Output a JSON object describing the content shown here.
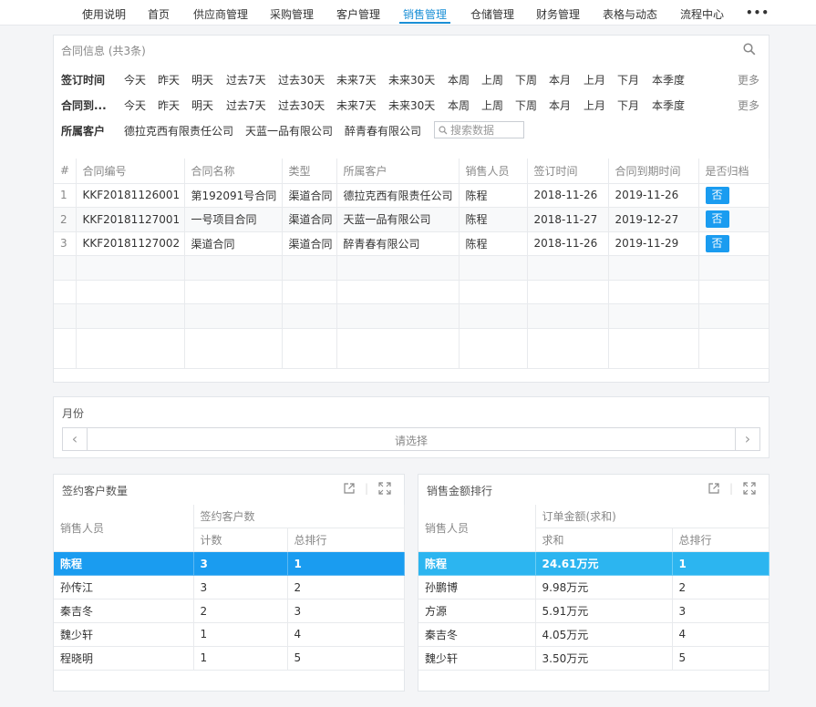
{
  "nav": {
    "items": [
      "使用说明",
      "首页",
      "供应商管理",
      "采购管理",
      "客户管理",
      "销售管理",
      "仓储管理",
      "财务管理",
      "表格与动态",
      "流程中心"
    ],
    "active": "销售管理",
    "more": "•••"
  },
  "contract": {
    "title": "合同信息 (共3条)",
    "filters": [
      {
        "label": "签订时间",
        "options": [
          "今天",
          "昨天",
          "明天",
          "过去7天",
          "过去30天",
          "未来7天",
          "未来30天",
          "本周",
          "上周",
          "下周",
          "本月",
          "上月",
          "下月",
          "本季度"
        ],
        "more": "更多"
      },
      {
        "label": "合同到...",
        "options": [
          "今天",
          "昨天",
          "明天",
          "过去7天",
          "过去30天",
          "未来7天",
          "未来30天",
          "本周",
          "上周",
          "下周",
          "本月",
          "上月",
          "下月",
          "本季度"
        ],
        "more": "更多"
      }
    ],
    "customer_filter": {
      "label": "所属客户",
      "options": [
        "德拉克西有限责任公司",
        "天蓝一品有限公司",
        "醉青春有限公司"
      ],
      "search_placeholder": "搜索数据"
    },
    "columns": [
      "#",
      "合同编号",
      "合同名称",
      "类型",
      "所属客户",
      "销售人员",
      "签订时间",
      "合同到期时间",
      "是否归档"
    ],
    "rows": [
      [
        "1",
        "KKF20181126001",
        "第192091号合同",
        "渠道合同",
        "德拉克西有限责任公司",
        "陈程",
        "2018-11-26",
        "2019-11-26",
        "否"
      ],
      [
        "2",
        "KKF20181127001",
        "一号项目合同",
        "渠道合同",
        "天蓝一品有限公司",
        "陈程",
        "2018-11-27",
        "2019-12-27",
        "否"
      ],
      [
        "3",
        "KKF20181127002",
        "渠道合同",
        "渠道合同",
        "醉青春有限公司",
        "陈程",
        "2018-11-26",
        "2019-11-29",
        "否"
      ]
    ]
  },
  "month": {
    "label": "月份",
    "placeholder": "请选择",
    "prev": "‹",
    "next": "›"
  },
  "signed_customers": {
    "title": "签约客户数量",
    "group_header": "销售人员",
    "metric_header": "签约客户数",
    "sub_headers": [
      "计数",
      "总排行"
    ],
    "rows": [
      [
        "陈程",
        "3",
        "1"
      ],
      [
        "孙传江",
        "3",
        "2"
      ],
      [
        "秦吉冬",
        "2",
        "3"
      ],
      [
        "魏少轩",
        "1",
        "4"
      ],
      [
        "程晓明",
        "1",
        "5"
      ]
    ]
  },
  "sales_rank": {
    "title": "销售金额排行",
    "group_header": "销售人员",
    "metric_header": "订单金额(求和)",
    "sub_headers": [
      "求和",
      "总排行"
    ],
    "rows": [
      [
        "陈程",
        "24.61万元",
        "1"
      ],
      [
        "孙鹏博",
        "9.98万元",
        "2"
      ],
      [
        "方源",
        "5.91万元",
        "3"
      ],
      [
        "秦吉冬",
        "4.05万元",
        "4"
      ],
      [
        "魏少轩",
        "3.50万元",
        "5"
      ]
    ]
  },
  "colors": {
    "accent": "#1a9cf0",
    "nav_active": "#1a8fd6"
  }
}
